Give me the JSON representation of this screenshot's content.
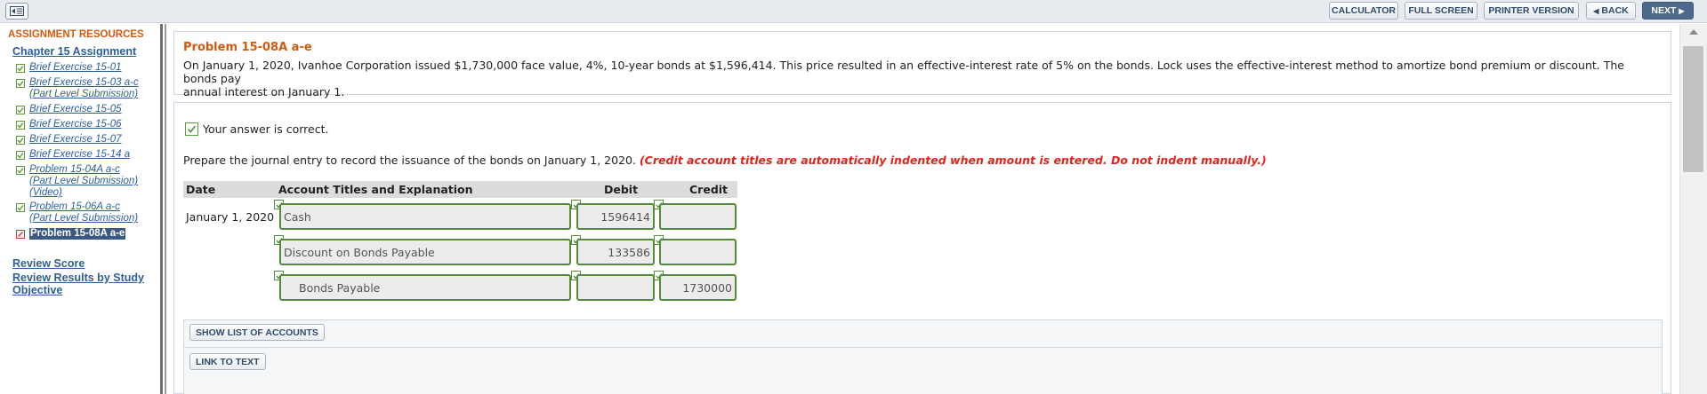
{
  "toolbar": {
    "calculator": "CALCULATOR",
    "full_screen": "FULL SCREEN",
    "printer_version": "PRINTER VERSION",
    "back": "BACK",
    "next": "NEXT"
  },
  "sidebar": {
    "title": "ASSIGNMENT RESOURCES",
    "chapter": "Chapter 15 Assignment",
    "items": [
      {
        "lines": [
          "Brief Exercise 15-01"
        ],
        "status": "complete"
      },
      {
        "lines": [
          "Brief Exercise 15-03 a-c",
          "(Part Level Submission)"
        ],
        "status": "complete"
      },
      {
        "lines": [
          "Brief Exercise 15-05"
        ],
        "status": "complete"
      },
      {
        "lines": [
          "Brief Exercise 15-06"
        ],
        "status": "complete"
      },
      {
        "lines": [
          "Brief Exercise 15-07"
        ],
        "status": "complete"
      },
      {
        "lines": [
          "Brief Exercise 15-14 a"
        ],
        "status": "complete"
      },
      {
        "lines": [
          "Problem 15-04A a-c",
          "(Part Level Submission)",
          "(Video)"
        ],
        "status": "complete"
      },
      {
        "lines": [
          "Problem 15-06A a-c",
          "(Part Level Submission)"
        ],
        "status": "complete"
      },
      {
        "lines": [
          "Problem 15-08A a-e"
        ],
        "status": "current"
      }
    ],
    "review_score": "Review Score",
    "review_results": [
      "Review Results by Study",
      "Objective"
    ]
  },
  "problem": {
    "title": "Problem 15-08A a-e",
    "text_line1": "On January 1, 2020, Ivanhoe Corporation issued $1,730,000 face value, 4%, 10-year bonds at $1,596,414. This price resulted in an effective-interest rate of 5% on the bonds. Lock uses the effective-interest method to amortize bond premium or discount. The bonds pay",
    "text_line2": "annual interest on January 1."
  },
  "answer": {
    "correct_message": "Your answer is correct.",
    "instruction": "Prepare the journal entry to record the issuance of the bonds on January 1, 2020.",
    "instruction_note": "(Credit account titles are automatically indented when amount is entered. Do not indent manually.)",
    "headers": {
      "date": "Date",
      "account": "Account Titles and Explanation",
      "debit": "Debit",
      "credit": "Credit"
    },
    "date": "January 1, 2020",
    "rows": [
      {
        "account": "Cash",
        "debit": "1596414",
        "credit": ""
      },
      {
        "account": "Discount on Bonds Payable",
        "debit": "133586",
        "credit": ""
      },
      {
        "account": "Bonds Payable",
        "debit": "",
        "credit": "1730000"
      }
    ],
    "show_list_button": "SHOW LIST OF ACCOUNTS",
    "link_to_text_button": "LINK TO TEXT"
  },
  "colors": {
    "accent_orange": "#d25a12",
    "link_blue": "#2b5f9e",
    "correct_green": "#548c3c",
    "note_red": "#e0231b"
  }
}
